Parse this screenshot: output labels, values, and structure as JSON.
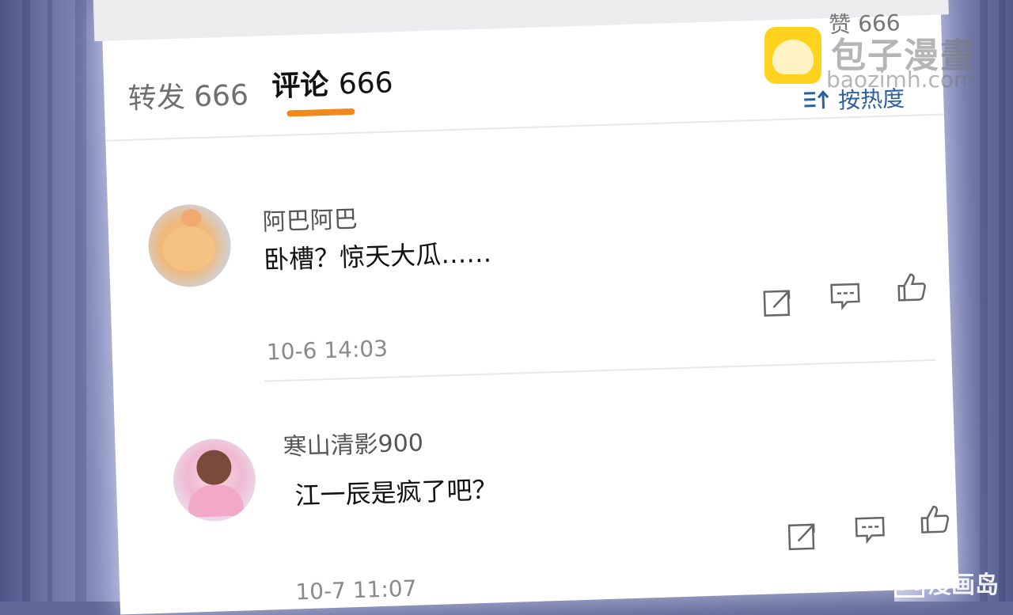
{
  "header": {
    "tabs": [
      {
        "label": "转发",
        "count": "666"
      },
      {
        "label": "评论",
        "count": "666",
        "active": true
      }
    ],
    "like_label": "赞",
    "like_count": "666",
    "sort_icon": "sort-icon",
    "sort_label": "按热度"
  },
  "comments": [
    {
      "username": "阿巴阿巴",
      "text": "卧槽？惊天大瓜……",
      "time": "10-6 14:03"
    },
    {
      "username": "寒山清影900",
      "text": "江一辰是疯了吧？",
      "time": "10-7 11:07"
    }
  ],
  "actions": [
    "share-icon",
    "comment-icon",
    "thumbs-up-icon"
  ],
  "watermark": {
    "brand": "包子漫畫",
    "url": "baozimh.com",
    "corner_text": "漫画岛",
    "corner_letter": "M"
  },
  "colors": {
    "accent": "#f08a1c",
    "sort": "#2c5fa0",
    "background": "#5f6796"
  }
}
